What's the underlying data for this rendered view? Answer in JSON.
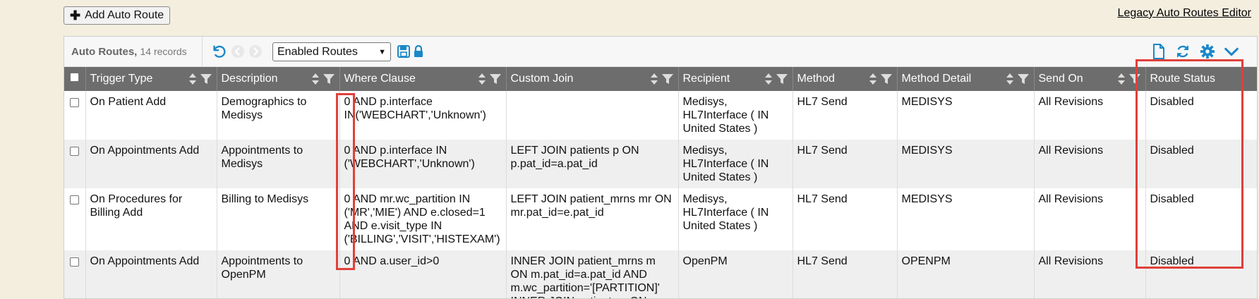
{
  "actions": {
    "add_label": "Add Auto Route",
    "legacy_label": "Legacy Auto Routes Editor"
  },
  "toolbar": {
    "title": "Auto Routes,",
    "count": "14 records",
    "filter_selected": "Enabled Routes",
    "icons": [
      "undo-icon",
      "prev-icon",
      "next-icon",
      "save-icon",
      "lock-icon",
      "new-document-icon",
      "refresh-icon",
      "settings-icon",
      "collapse-icon"
    ]
  },
  "columns": [
    {
      "label": "Trigger Type"
    },
    {
      "label": "Description"
    },
    {
      "label": "Where Clause"
    },
    {
      "label": "Custom Join"
    },
    {
      "label": "Recipient"
    },
    {
      "label": "Method"
    },
    {
      "label": "Method Detail"
    },
    {
      "label": "Send On"
    },
    {
      "label": "Route Status"
    }
  ],
  "rows": [
    {
      "trigger": "On Patient Add",
      "description": "Demographics to Medisys",
      "where": "0 AND p.interface IN('WEBCHART','Unknown')",
      "join": "",
      "recipient": "Medisys, HL7Interface ( IN United States )",
      "method": "HL7 Send",
      "detail": "MEDISYS",
      "send_on": "All Revisions",
      "status": "Disabled"
    },
    {
      "trigger": "On Appointments Add",
      "description": "Appointments to Medisys",
      "where": "0 AND p.interface IN ('WEBCHART','Unknown')",
      "join": "LEFT JOIN patients p ON p.pat_id=a.pat_id",
      "recipient": "Medisys, HL7Interface ( IN United States )",
      "method": "HL7 Send",
      "detail": "MEDISYS",
      "send_on": "All Revisions",
      "status": "Disabled"
    },
    {
      "trigger": "On Procedures for Billing Add",
      "description": "Billing to Medisys",
      "where": "0 AND mr.wc_partition IN ('MR','MIE') AND e.closed=1 AND e.visit_type IN ('BILLING','VISIT','HISTEXAM')",
      "join": "LEFT JOIN patient_mrns mr ON mr.pat_id=e.pat_id",
      "recipient": "Medisys, HL7Interface ( IN United States )",
      "method": "HL7 Send",
      "detail": "MEDISYS",
      "send_on": "All Revisions",
      "status": "Disabled"
    },
    {
      "trigger": "On Appointments Add",
      "description": "Appointments to OpenPM",
      "where": "0 AND a.user_id>0",
      "join": "INNER JOIN patient_mrns m ON m.pat_id=a.pat_id AND m.wc_partition='[PARTITION]' INNER JOIN patients p ON",
      "recipient": "OpenPM",
      "method": "HL7 Send",
      "detail": "OPENPM",
      "send_on": "All Revisions",
      "status": "Disabled"
    }
  ],
  "colors": {
    "page_bg": "#f4eedf",
    "header_bg": "#6d6d6d",
    "icon_blue": "#1a88c9",
    "highlight": "#e0403a"
  }
}
